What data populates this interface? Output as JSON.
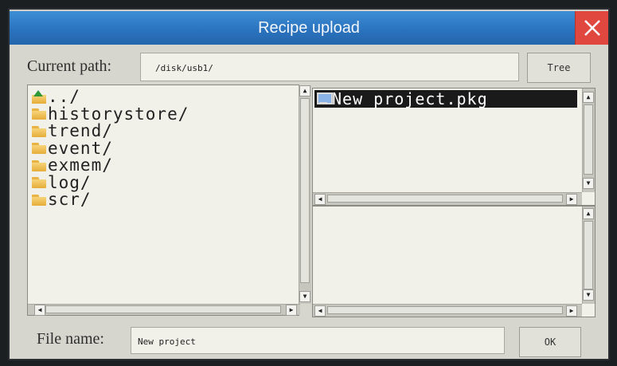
{
  "dialog": {
    "title": "Recipe upload",
    "close_icon": "close-x-icon",
    "accent_color": "#2b73be",
    "close_color": "#e0473e"
  },
  "path": {
    "label": "Current path:",
    "value": "/disk/usb1/",
    "tree_button": "Tree"
  },
  "directory_list": {
    "items": [
      {
        "label": "../",
        "icon": "folder-up-icon"
      },
      {
        "label": "historystore/",
        "icon": "folder-icon"
      },
      {
        "label": "trend/",
        "icon": "folder-icon"
      },
      {
        "label": "event/",
        "icon": "folder-icon"
      },
      {
        "label": "exmem/",
        "icon": "folder-icon"
      },
      {
        "label": "log/",
        "icon": "folder-icon"
      },
      {
        "label": "scr/",
        "icon": "folder-icon"
      }
    ]
  },
  "file_list": {
    "items": [
      {
        "label": "New project.pkg",
        "icon": "computer-icon",
        "selected": true
      }
    ]
  },
  "filename": {
    "label": "File name:",
    "value": "New project",
    "ok_button": "OK"
  }
}
